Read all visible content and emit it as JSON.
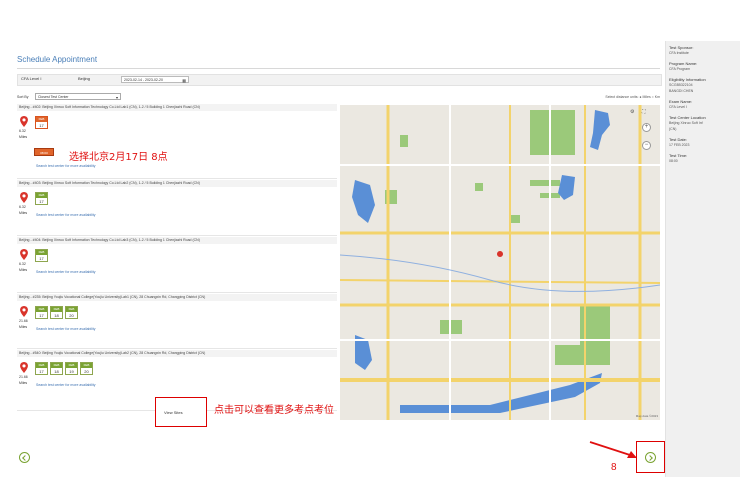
{
  "page": {
    "title": "Schedule Appointment",
    "filters": {
      "level": "CFA Level I",
      "city": "Beijing",
      "date_range": "2023-02-14 - 2023-02-20"
    },
    "sort": {
      "label": "Sort By",
      "selected": "Closest Test Center"
    },
    "distance_units": "Select distance units: ● Miles ○ Km"
  },
  "centers": [
    {
      "name": "Beijing - #402: Beijing Xinruo Soft Information Technology Co.Ltd Lab1 (CN), 1-2 / 5 Building 1 Chenjiazhi Road (CN)",
      "distance": "6.32",
      "distance_unit": "Miles",
      "dates": [
        {
          "month": "FEB",
          "day": "17",
          "selected": true
        }
      ],
      "slot": "08:00",
      "more": "Search test center for more availability"
    },
    {
      "name": "Beijing - #403: Beijing Xinruo Soft Information Technology Co.Ltd Lab2 (CN), 1-2 / 5 Building 1 Chenjiazhi Road (CN)",
      "distance": "6.32",
      "distance_unit": "Miles",
      "dates": [
        {
          "month": "FEB",
          "day": "17",
          "selected": false
        }
      ],
      "more": "Search test center for more availability"
    },
    {
      "name": "Beijing - #404: Beijing Xinruo Soft Information Technology Co.Ltd Lab3 (CN), 1-2 / 5 Building 1 Chenjiazhi Road (CN)",
      "distance": "6.32",
      "distance_unit": "Miles",
      "dates": [
        {
          "month": "FEB",
          "day": "17",
          "selected": false
        }
      ],
      "more": "Search test center for more availability"
    },
    {
      "name": "Beijing - #235: Beijing Youjiu Vocational College(Youjiu University)Lab1 (CN), 28 Chuangxin Rd, Changping District (CN)",
      "distance": "21.66",
      "distance_unit": "Miles",
      "dates": [
        {
          "month": "FEB",
          "day": "17",
          "selected": false
        },
        {
          "month": "FEB",
          "day": "18",
          "selected": false
        },
        {
          "month": "FEB",
          "day": "20",
          "selected": false
        }
      ],
      "more": "Search test center for more availability"
    },
    {
      "name": "Beijing - #540: Beijing Youjiu Vocational College(Youjiu University)Lab2 (CN), 28 Chuangxin Rd, Changping District (CN)",
      "distance": "21.66",
      "distance_unit": "Miles",
      "dates": [
        {
          "month": "FEB",
          "day": "17",
          "selected": false
        },
        {
          "month": "FEB",
          "day": "18",
          "selected": false
        },
        {
          "month": "FEB",
          "day": "19",
          "selected": false
        },
        {
          "month": "FEB",
          "day": "20",
          "selected": false
        }
      ],
      "more": "Search test center for more availability"
    }
  ],
  "view_sites": "View Sites",
  "annotations": {
    "select_text": "选择北京2月17日 8点",
    "view_more_text": "点击可以查看更多考点考位",
    "step_number": "8"
  },
  "sidebar": {
    "fields": [
      {
        "label": "Test Sponsor:",
        "value": "CFA Institute"
      },
      {
        "label": "Program Name:",
        "value": "CFA Program"
      },
      {
        "label": "Eligibility Information",
        "value": "SCGB5322104",
        "value2": "BANGDI CHEN"
      },
      {
        "label": "Exam Name:",
        "value": "CFA Level I"
      },
      {
        "label": "Test Center Location",
        "value": "Beijing Xinruo Soft Inf",
        "value2": "(CN)"
      },
      {
        "label": "Test Date:",
        "value": "17 FEB 2023"
      },
      {
        "label": "Test Time:",
        "value": "08:00"
      }
    ]
  },
  "map": {
    "credit": "Map data ©2023",
    "colors": {
      "bg": "#ebe8e1",
      "park": "#9bc97a",
      "water": "#5a8fd6",
      "road_major": "#f3d36b",
      "road_minor": "#ffffff"
    }
  }
}
